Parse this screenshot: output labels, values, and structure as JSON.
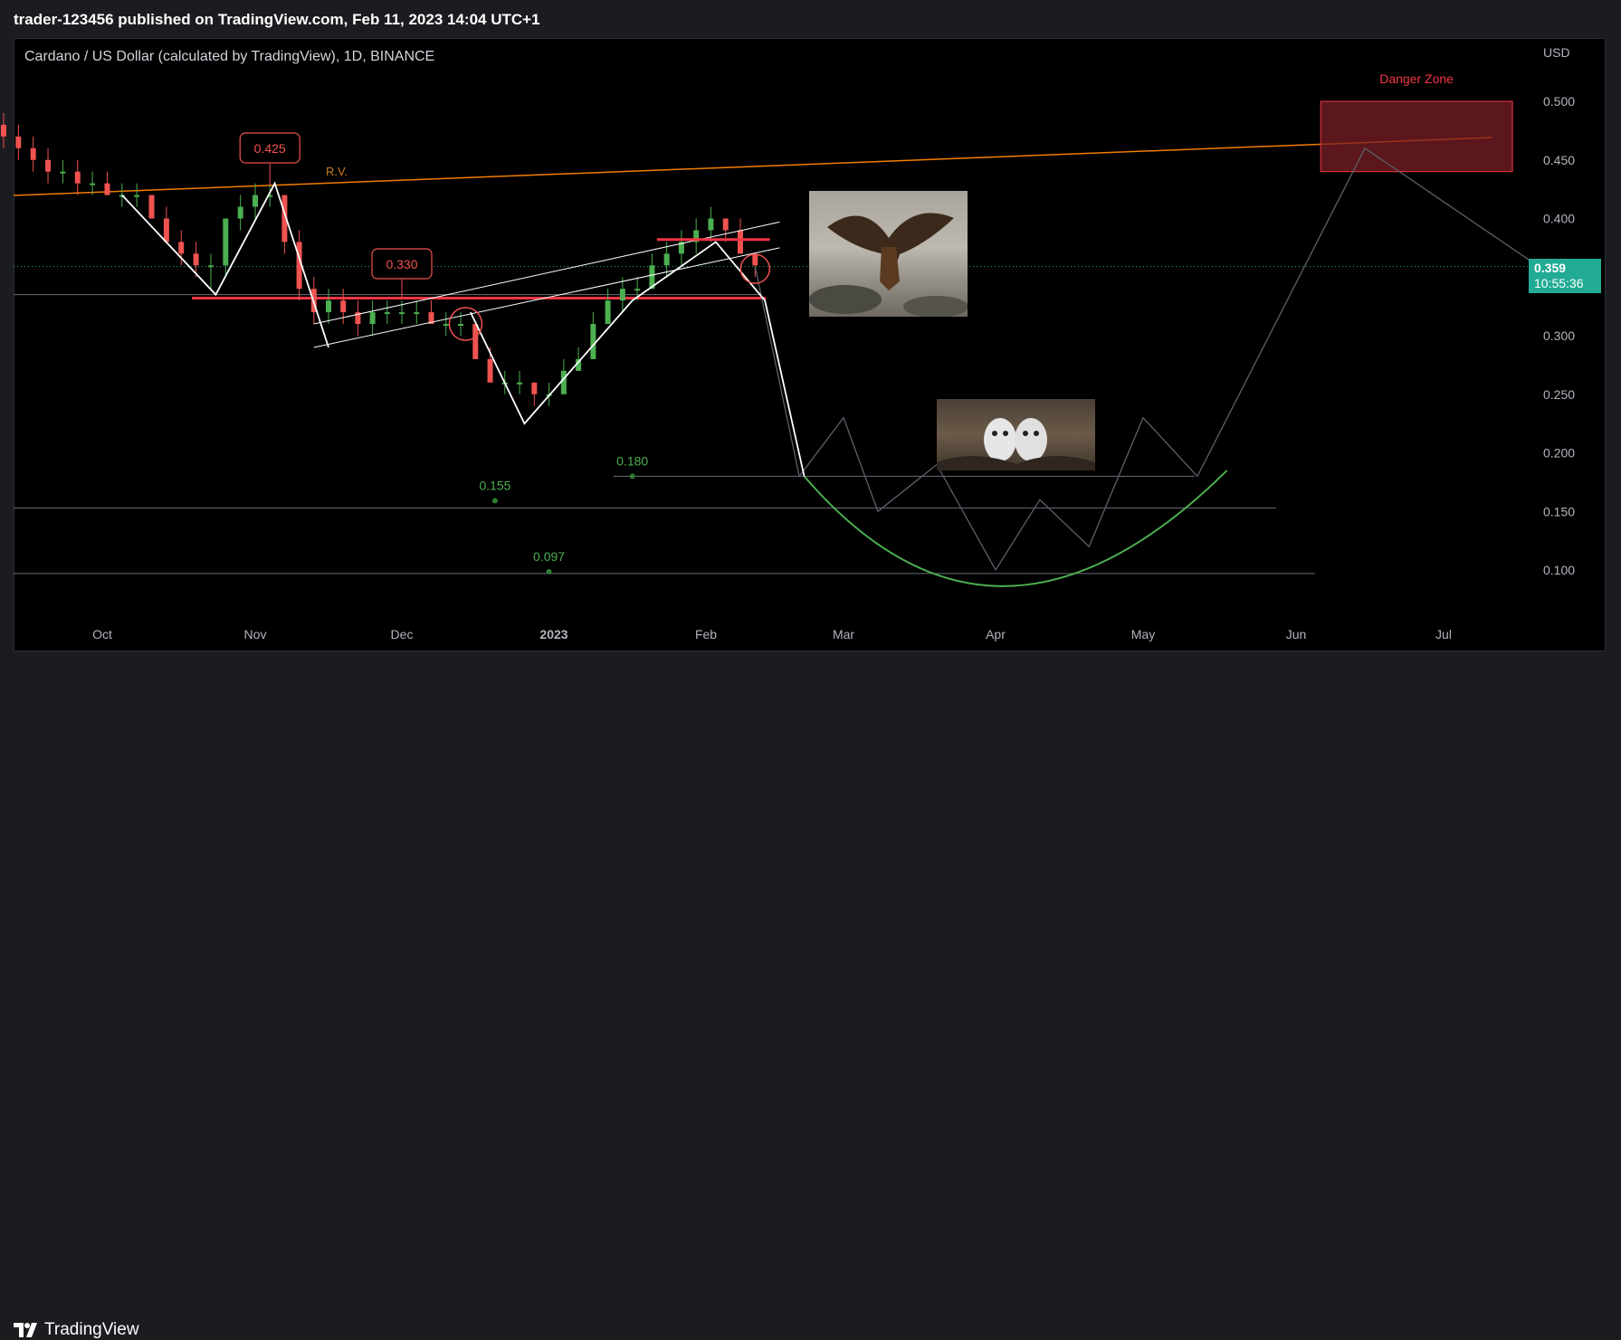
{
  "header": {
    "published_text": "trader-123456 published on TradingView.com, Feb 11, 2023 14:04 UTC+1"
  },
  "chart_header": {
    "title": "Cardano / US Dollar (calculated by TradingView), 1D, BINANCE",
    "currency": "USD"
  },
  "last_price": {
    "price": "0.359",
    "countdown": "10:55:36",
    "color": "#22ab94"
  },
  "annotations": {
    "danger_zone": "Danger Zone",
    "rv_label": "R.V.",
    "label_425": "0.425",
    "label_330": "0.330",
    "label_180": "0.180",
    "label_155": "0.155",
    "label_097": "0.097"
  },
  "images": {
    "eagle_icon": "eagle-photo",
    "chicks_icon": "eagle-chicks-photo"
  },
  "footer": {
    "brand": "TradingView"
  },
  "colors": {
    "up": "#26a69a",
    "up_bright": "#4caf50",
    "down": "#ef5350",
    "support": "#f23645",
    "resistance_orange": "#f57c00",
    "bowl": "#4caf50",
    "danger_fill": "#7a1f25"
  },
  "chart_data": {
    "type": "line",
    "title": "Cardano / US Dollar (calculated by TradingView), 1D, BINANCE",
    "xlabel": "",
    "ylabel": "USD",
    "ylim": [
      0.06,
      0.55
    ],
    "y_ticks": [
      "0.500",
      "0.450",
      "0.400",
      "0.350",
      "0.300",
      "0.250",
      "0.200",
      "0.150",
      "0.100"
    ],
    "x_ticks": [
      "Oct",
      "Nov",
      "Dec",
      "2023",
      "Feb",
      "Mar",
      "Apr",
      "May",
      "Jun",
      "Jul"
    ],
    "grid": false,
    "legend": "none",
    "series": [
      {
        "kind": "candles-history",
        "points": [
          [
            "2022-09-11",
            0.48,
            0.49,
            0.46,
            0.47
          ],
          [
            "2022-09-14",
            0.47,
            0.48,
            0.45,
            0.46
          ],
          [
            "2022-09-17",
            0.46,
            0.47,
            0.44,
            0.45
          ],
          [
            "2022-09-20",
            0.45,
            0.46,
            0.43,
            0.44
          ],
          [
            "2022-09-23",
            0.44,
            0.45,
            0.43,
            0.44
          ],
          [
            "2022-09-26",
            0.44,
            0.45,
            0.42,
            0.43
          ],
          [
            "2022-09-29",
            0.43,
            0.44,
            0.42,
            0.43
          ],
          [
            "2022-10-02",
            0.43,
            0.44,
            0.42,
            0.42
          ],
          [
            "2022-10-05",
            0.42,
            0.43,
            0.41,
            0.42
          ],
          [
            "2022-10-08",
            0.42,
            0.43,
            0.41,
            0.42
          ],
          [
            "2022-10-11",
            0.42,
            0.42,
            0.4,
            0.4
          ],
          [
            "2022-10-14",
            0.4,
            0.41,
            0.38,
            0.38
          ],
          [
            "2022-10-17",
            0.38,
            0.39,
            0.36,
            0.37
          ],
          [
            "2022-10-20",
            0.37,
            0.38,
            0.35,
            0.36
          ],
          [
            "2022-10-23",
            0.36,
            0.37,
            0.34,
            0.36
          ],
          [
            "2022-10-26",
            0.36,
            0.4,
            0.35,
            0.4
          ],
          [
            "2022-10-29",
            0.4,
            0.42,
            0.39,
            0.41
          ],
          [
            "2022-11-01",
            0.41,
            0.43,
            0.4,
            0.42
          ],
          [
            "2022-11-04",
            0.42,
            0.43,
            0.41,
            0.42
          ],
          [
            "2022-11-07",
            0.42,
            0.42,
            0.37,
            0.38
          ],
          [
            "2022-11-10",
            0.38,
            0.39,
            0.33,
            0.34
          ],
          [
            "2022-11-13",
            0.34,
            0.35,
            0.31,
            0.32
          ],
          [
            "2022-11-16",
            0.32,
            0.34,
            0.31,
            0.33
          ],
          [
            "2022-11-19",
            0.33,
            0.34,
            0.31,
            0.32
          ],
          [
            "2022-11-22",
            0.32,
            0.33,
            0.3,
            0.31
          ],
          [
            "2022-11-25",
            0.31,
            0.33,
            0.3,
            0.32
          ],
          [
            "2022-11-28",
            0.32,
            0.33,
            0.31,
            0.32
          ],
          [
            "2022-12-01",
            0.32,
            0.33,
            0.31,
            0.32
          ],
          [
            "2022-12-04",
            0.32,
            0.33,
            0.31,
            0.32
          ],
          [
            "2022-12-07",
            0.32,
            0.33,
            0.31,
            0.31
          ],
          [
            "2022-12-10",
            0.31,
            0.32,
            0.3,
            0.31
          ],
          [
            "2022-12-13",
            0.31,
            0.32,
            0.3,
            0.31
          ],
          [
            "2022-12-16",
            0.31,
            0.31,
            0.28,
            0.28
          ],
          [
            "2022-12-19",
            0.28,
            0.29,
            0.26,
            0.26
          ],
          [
            "2022-12-22",
            0.26,
            0.27,
            0.25,
            0.26
          ],
          [
            "2022-12-25",
            0.26,
            0.27,
            0.25,
            0.26
          ],
          [
            "2022-12-28",
            0.26,
            0.26,
            0.24,
            0.25
          ],
          [
            "2022-12-31",
            0.25,
            0.26,
            0.24,
            0.25
          ],
          [
            "2023-01-03",
            0.25,
            0.28,
            0.25,
            0.27
          ],
          [
            "2023-01-06",
            0.27,
            0.29,
            0.27,
            0.28
          ],
          [
            "2023-01-09",
            0.28,
            0.32,
            0.28,
            0.31
          ],
          [
            "2023-01-12",
            0.31,
            0.34,
            0.31,
            0.33
          ],
          [
            "2023-01-15",
            0.33,
            0.35,
            0.32,
            0.34
          ],
          [
            "2023-01-18",
            0.34,
            0.35,
            0.33,
            0.34
          ],
          [
            "2023-01-21",
            0.34,
            0.37,
            0.34,
            0.36
          ],
          [
            "2023-01-24",
            0.36,
            0.38,
            0.35,
            0.37
          ],
          [
            "2023-01-27",
            0.37,
            0.39,
            0.36,
            0.38
          ],
          [
            "2023-01-30",
            0.38,
            0.4,
            0.37,
            0.39
          ],
          [
            "2023-02-02",
            0.39,
            0.41,
            0.38,
            0.4
          ],
          [
            "2023-02-05",
            0.4,
            0.4,
            0.38,
            0.39
          ],
          [
            "2023-02-08",
            0.39,
            0.4,
            0.37,
            0.37
          ],
          [
            "2023-02-11",
            0.37,
            0.37,
            0.35,
            0.36
          ]
        ]
      }
    ],
    "horizontal_levels": [
      {
        "name": "support",
        "y": 0.332
      },
      {
        "name": "0.180",
        "y": 0.18
      },
      {
        "name": "0.155",
        "y": 0.153
      },
      {
        "name": "0.097",
        "y": 0.097
      }
    ],
    "callouts": [
      {
        "label": "0.425",
        "x": "2022-11-04",
        "y": 0.425
      },
      {
        "label": "0.330",
        "x": "2022-12-01",
        "y": 0.33
      },
      {
        "label": "0.180",
        "x": "2023-01-17",
        "y": 0.18
      },
      {
        "label": "0.155",
        "x": "2022-12-20",
        "y": 0.155
      },
      {
        "label": "0.097",
        "x": "2022-12-31",
        "y": 0.097
      }
    ],
    "projection_path": [
      [
        "2023-02-11",
        0.359
      ],
      [
        "2023-02-20",
        0.18
      ],
      [
        "2023-03-01",
        0.23
      ],
      [
        "2023-03-08",
        0.15
      ],
      [
        "2023-03-20",
        0.19
      ],
      [
        "2023-04-01",
        0.1
      ],
      [
        "2023-04-10",
        0.16
      ],
      [
        "2023-04-20",
        0.12
      ],
      [
        "2023-05-01",
        0.23
      ],
      [
        "2023-05-12",
        0.18
      ],
      [
        "2023-06-15",
        0.46
      ],
      [
        "2023-07-20",
        0.36
      ]
    ],
    "danger_zone": {
      "label": "Danger Zone",
      "x0": "2023-06-06",
      "x1": "2023-07-15",
      "y0": 0.44,
      "y1": 0.5
    }
  }
}
